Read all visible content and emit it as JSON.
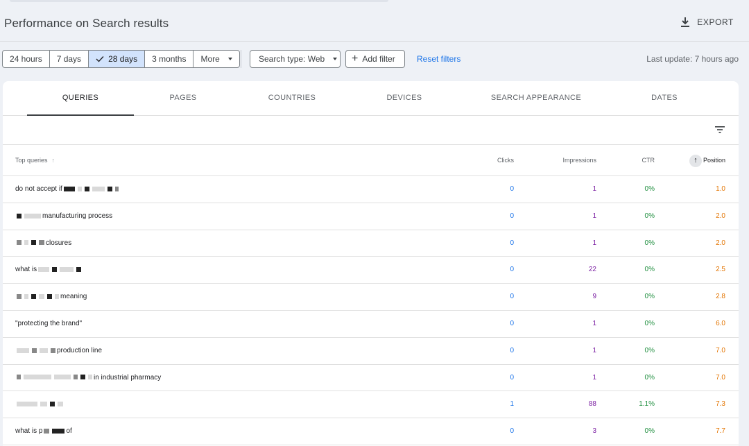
{
  "header": {
    "title": "Performance on Search results",
    "export_label": "EXPORT"
  },
  "toolbar": {
    "ranges": [
      "24 hours",
      "7 days",
      "28 days",
      "3 months",
      "More"
    ],
    "selected_range": "28 days",
    "search_type": "Search type: Web",
    "add_filter": "Add filter",
    "reset_filters": "Reset filters",
    "last_update": "Last update: 7 hours ago"
  },
  "tabs": [
    "QUERIES",
    "PAGES",
    "COUNTRIES",
    "DEVICES",
    "SEARCH APPEARANCE",
    "DATES"
  ],
  "table": {
    "headers": {
      "query": "Top queries",
      "clicks": "Clicks",
      "impressions": "Impressions",
      "ctr": "CTR",
      "position": "Position"
    },
    "rows": [
      {
        "query_prefix": "do not accept if",
        "query_suffix": "",
        "clicks": "0",
        "impressions": "1",
        "ctr": "0%",
        "position": "1.0"
      },
      {
        "query_prefix": "",
        "query_suffix": "manufacturing process",
        "clicks": "0",
        "impressions": "1",
        "ctr": "0%",
        "position": "2.0"
      },
      {
        "query_prefix": "",
        "query_suffix": "closures",
        "clicks": "0",
        "impressions": "1",
        "ctr": "0%",
        "position": "2.0"
      },
      {
        "query_prefix": "what is",
        "query_suffix": "",
        "clicks": "0",
        "impressions": "22",
        "ctr": "0%",
        "position": "2.5"
      },
      {
        "query_prefix": "",
        "query_suffix": "meaning",
        "clicks": "0",
        "impressions": "9",
        "ctr": "0%",
        "position": "2.8"
      },
      {
        "query_prefix": "\"protecting the brand\"",
        "query_suffix": "",
        "clicks": "0",
        "impressions": "1",
        "ctr": "0%",
        "position": "6.0"
      },
      {
        "query_prefix": "",
        "query_suffix": "production line",
        "clicks": "0",
        "impressions": "1",
        "ctr": "0%",
        "position": "7.0"
      },
      {
        "query_prefix": "",
        "query_suffix": "in industrial pharmacy",
        "clicks": "0",
        "impressions": "1",
        "ctr": "0%",
        "position": "7.0"
      },
      {
        "query_prefix": "",
        "query_suffix": "",
        "clicks": "1",
        "impressions": "88",
        "ctr": "1.1%",
        "position": "7.3"
      },
      {
        "query_prefix": "what is p",
        "query_suffix": "of",
        "clicks": "0",
        "impressions": "3",
        "ctr": "0%",
        "position": "7.7"
      }
    ]
  },
  "colors": {
    "clicks": "#1a73e8",
    "impressions": "#7b1fa2",
    "ctr": "#1e8e3e",
    "position": "#e37400",
    "selected_range_bg": "#d2e3fc"
  },
  "icons": {
    "export": "download-icon",
    "check": "check-icon",
    "filter": "filter-list-icon",
    "sort": "arrow-up-icon"
  }
}
